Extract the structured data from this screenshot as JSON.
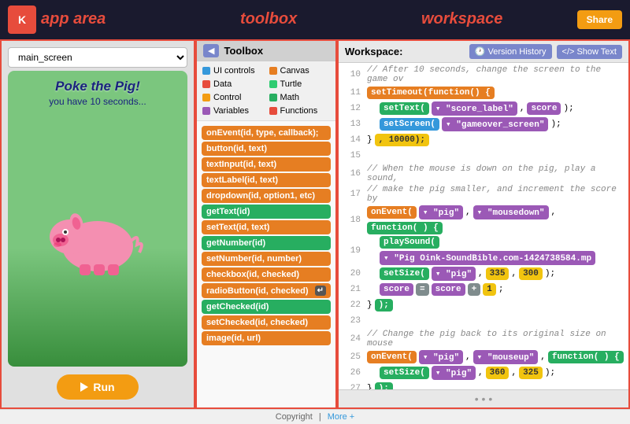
{
  "header": {
    "logo": "K",
    "labels": {
      "app_area": "app area",
      "toolbox": "toolbox",
      "workspace": "workspace"
    },
    "run_button": "Run",
    "share_button": "Share"
  },
  "app": {
    "screen_select": "main_screen",
    "title": "Poke the Pig!",
    "subtitle": "you have 10 seconds...",
    "run_label": "Run"
  },
  "toolbox": {
    "header_label": "Toolbox",
    "back": "◀",
    "categories": [
      {
        "label": "UI controls",
        "color": "#3498db"
      },
      {
        "label": "Canvas",
        "color": "#e67e22"
      },
      {
        "label": "Data",
        "color": "#e74c3c"
      },
      {
        "label": "Turtle",
        "color": "#2ecc71"
      },
      {
        "label": "Control",
        "color": "#f39c12"
      },
      {
        "label": "Math",
        "color": "#27ae60"
      },
      {
        "label": "Variables",
        "color": "#9b59b6"
      },
      {
        "label": "Functions",
        "color": "#e74c3c"
      }
    ],
    "blocks": [
      {
        "label": "onEvent(id, type, callback);",
        "color": "orange"
      },
      {
        "label": "button(id, text)",
        "color": "orange"
      },
      {
        "label": "textInput(id, text)",
        "color": "orange"
      },
      {
        "label": "textLabel(id, text)",
        "color": "orange"
      },
      {
        "label": "dropdown(id, option1, etc)",
        "color": "orange"
      },
      {
        "label": "getText(id)",
        "color": "green"
      },
      {
        "label": "setText(id, text)",
        "color": "orange"
      },
      {
        "label": "getNumber(id)",
        "color": "green"
      },
      {
        "label": "setNumber(id, number)",
        "color": "orange"
      },
      {
        "label": "checkbox(id, checked)",
        "color": "orange"
      },
      {
        "label": "radioButton(id, checked)",
        "color": "orange"
      },
      {
        "label": "getChecked(id)",
        "color": "green"
      },
      {
        "label": "setChecked(id, checked)",
        "color": "orange"
      },
      {
        "label": "image(id, url)",
        "color": "orange"
      }
    ]
  },
  "workspace": {
    "header_label": "Workspace:",
    "version_history": "Version History",
    "show_text": "Show Text",
    "lines": [
      {
        "num": 10,
        "type": "comment",
        "text": "// After 10 seconds, change the screen to the game ov"
      },
      {
        "num": 11,
        "type": "block",
        "content": "setTimeout"
      },
      {
        "num": 12,
        "type": "block2",
        "content": "setText"
      },
      {
        "num": 13,
        "type": "block3",
        "content": "setScreen"
      },
      {
        "num": 14,
        "type": "close",
        "content": "10000"
      },
      {
        "num": 15,
        "type": "empty"
      },
      {
        "num": 16,
        "type": "comment",
        "text": "// When the mouse is down on the pig, play a sound,"
      },
      {
        "num": 17,
        "type": "comment",
        "text": "// make the pig smaller, and increment the score by"
      },
      {
        "num": 18,
        "type": "block",
        "content": "onEvent_pig"
      },
      {
        "num": 19,
        "type": "block2",
        "content": "playSound"
      },
      {
        "num": 20,
        "type": "block3",
        "content": "setSize_pig"
      },
      {
        "num": 21,
        "type": "block4",
        "content": "score_incr"
      },
      {
        "num": 22,
        "type": "close2"
      },
      {
        "num": 23,
        "type": "empty"
      },
      {
        "num": 24,
        "type": "comment",
        "text": "// Change the pig back to its original size on mouse"
      },
      {
        "num": 25,
        "type": "block",
        "content": "onEvent_pig2"
      },
      {
        "num": 26,
        "type": "block3",
        "content": "setSize_pig2"
      },
      {
        "num": 27,
        "type": "close3"
      }
    ]
  },
  "footer": {
    "copyright": "Copyright",
    "more": "More +"
  }
}
